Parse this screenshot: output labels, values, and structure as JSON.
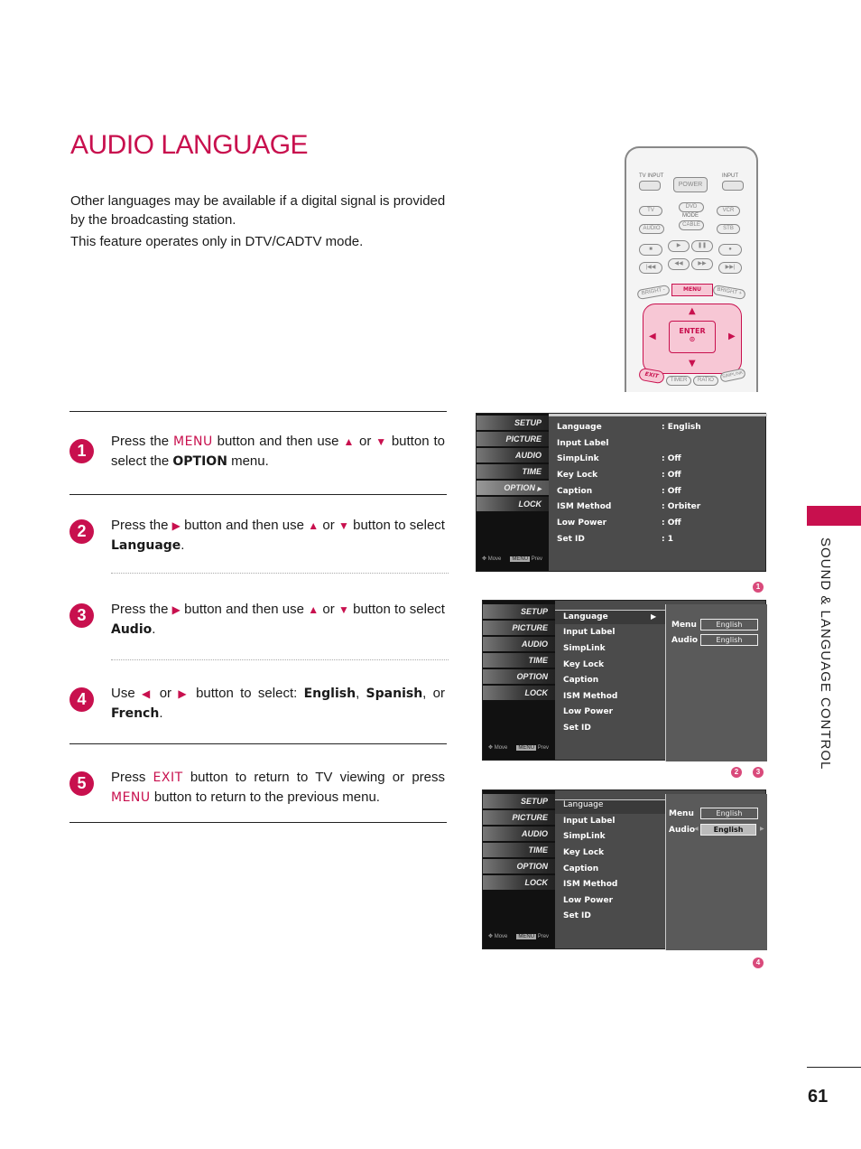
{
  "page": {
    "title": "AUDIO LANGUAGE",
    "intro": [
      "Other languages may be available if a digital signal is provided by the broadcasting station.",
      "This feature operates only in DTV/CADTV mode."
    ],
    "section_label": "SOUND & LANGUAGE CONTROL",
    "page_number": "61",
    "accent_color": "#c8104e"
  },
  "steps": [
    {
      "num": "1",
      "t1": "Press the ",
      "k1": "MENU",
      "t2": " button and then use ",
      "up": "▲",
      "t3": " or ",
      "down": "▼",
      "t4": " button to select the ",
      "k2": "OPTION",
      "t5": " menu."
    },
    {
      "num": "2",
      "t1": "Press the ",
      "right": "▶",
      "t2": " button and then use ",
      "up": "▲",
      "t3": " or ",
      "down": "▼",
      "t4": " button to select ",
      "k1": "Language",
      "t5": "."
    },
    {
      "num": "3",
      "t1": "Press the ",
      "right": "▶",
      "t2": " button and then use ",
      "up": "▲",
      "t3": " or ",
      "down": "▼",
      "t4": " button to select ",
      "k1": "Audio",
      "t5": "."
    },
    {
      "num": "4",
      "t1": "Use ",
      "left": "◀",
      "t2": " or ",
      "right": "▶",
      "t3": " button to select: ",
      "k1": "English",
      "t4": ", ",
      "k2": "Spanish",
      "t5": ", or ",
      "k3": "French",
      "t6": "."
    },
    {
      "num": "5",
      "t1": "Press ",
      "k1": "EXIT",
      "t2": " button to return to TV viewing or press ",
      "k2": "MENU",
      "t3": " button to return to the previous menu."
    }
  ],
  "remote": {
    "tv_input": "TV INPUT",
    "input": "INPUT",
    "power": "POWER",
    "tv": "TV",
    "dvd": "DVD",
    "vcr": "VCR",
    "mode": "MODE",
    "audio": "AUDIO",
    "cable": "CABLE",
    "stb": "STB",
    "stop": "■",
    "play": "▶",
    "pause": "❚❚",
    "rec": "●",
    "prev": "|◀◀",
    "rew": "◀◀",
    "ff": "▶▶",
    "next": "▶▶|",
    "bright_minus": "BRIGHT -",
    "menu": "MENU",
    "bright_plus": "BRIGHT +",
    "enter": "ENTER",
    "enter_dot": "⊙",
    "up": "▲",
    "down": "▼",
    "left": "◀",
    "right": "▶",
    "exit": "EXIT",
    "timer": "TIMER",
    "ratio": "RATIO",
    "simplink": "SIMPLINK"
  },
  "osd": {
    "side_menu": [
      "SETUP",
      "PICTURE",
      "AUDIO",
      "TIME",
      "OPTION",
      "LOCK"
    ],
    "footer_move": "Move",
    "footer_key": "MENU",
    "footer_prev": "Prev",
    "option_items": [
      "Language",
      "Input Label",
      "SimpLink",
      "Key Lock",
      "Caption",
      "ISM Method",
      "Low Power",
      "Set ID"
    ],
    "option_values": [
      ": English",
      "",
      ": Off",
      ": Off",
      ": Off",
      ": Orbiter",
      ": Off",
      ": 1"
    ],
    "submenu_arrow": "▶",
    "lang_labels": [
      "Menu",
      "Audio"
    ],
    "lang_values": [
      "English",
      "English"
    ],
    "left_arrow": "◀",
    "right_arrow": "▶",
    "screen_tags": [
      "1",
      "2",
      "3",
      "4"
    ]
  }
}
